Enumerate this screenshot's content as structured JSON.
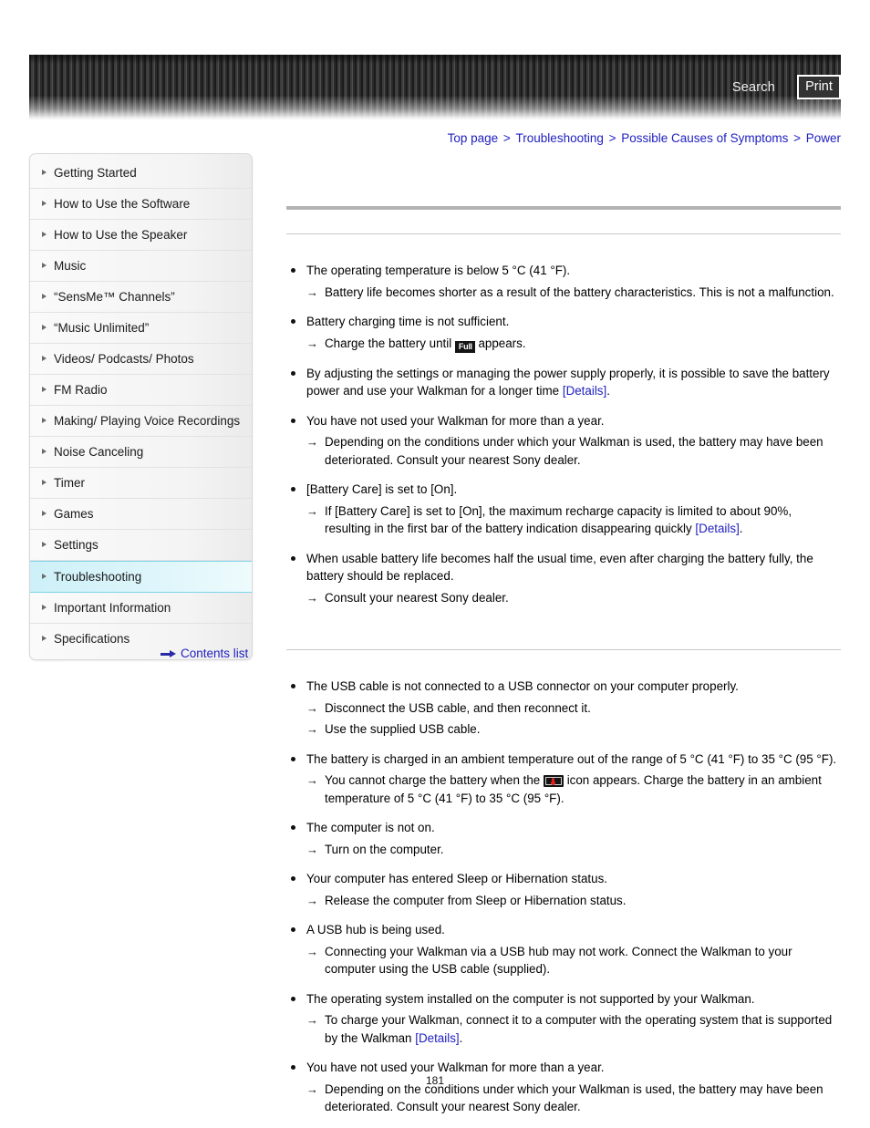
{
  "header": {
    "search_label": "Search",
    "print_label": "Print"
  },
  "breadcrumb": {
    "items": [
      "Top page",
      "Troubleshooting",
      "Possible Causes of Symptoms",
      "Power"
    ],
    "separator": ">"
  },
  "sidebar": {
    "items": [
      {
        "label": "Getting Started",
        "active": false
      },
      {
        "label": "How to Use the Software",
        "active": false
      },
      {
        "label": "How to Use the Speaker",
        "active": false
      },
      {
        "label": "Music",
        "active": false
      },
      {
        "label": "“SensMe™ Channels”",
        "active": false
      },
      {
        "label": "“Music Unlimited”",
        "active": false
      },
      {
        "label": "Videos/ Podcasts/ Photos",
        "active": false
      },
      {
        "label": "FM Radio",
        "active": false
      },
      {
        "label": "Making/ Playing Voice Recordings",
        "active": false
      },
      {
        "label": "Noise Canceling",
        "active": false
      },
      {
        "label": "Timer",
        "active": false
      },
      {
        "label": "Games",
        "active": false
      },
      {
        "label": "Settings",
        "active": false
      },
      {
        "label": "Troubleshooting",
        "active": true
      },
      {
        "label": "Important Information",
        "active": false
      },
      {
        "label": "Specifications",
        "active": false
      }
    ],
    "contents_list_label": "Contents list"
  },
  "content": {
    "section1": {
      "items": [
        {
          "text": "The operating temperature is below 5 °C (41 °F).",
          "subs": [
            {
              "text": "Battery life becomes shorter as a result of the battery characteristics. This is not a malfunction."
            }
          ]
        },
        {
          "text": "Battery charging time is not sufficient.",
          "subs": [
            {
              "before": "Charge the battery until ",
              "icon": "battery-full-icon",
              "icon_text": "Full",
              "after": " appears."
            }
          ]
        },
        {
          "before": "By adjusting the settings or managing the power supply properly, it is possible to save the battery power and use your Walkman for a longer time ",
          "link": "[Details]",
          "after": ".",
          "subs": []
        },
        {
          "text": "You have not used your Walkman for more than a year.",
          "subs": [
            {
              "text": "Depending on the conditions under which your Walkman is used, the battery may have been deteriorated. Consult your nearest Sony dealer."
            }
          ]
        },
        {
          "text": "[Battery Care] is set to [On].",
          "subs": [
            {
              "before": "If [Battery Care] is set to [On], the maximum recharge capacity is limited to about 90%, resulting in the first bar of the battery indication disappearing quickly ",
              "link": "[Details]",
              "after": "."
            }
          ]
        },
        {
          "text": "When usable battery life becomes half the usual time, even after charging the battery fully, the battery should be replaced.",
          "subs": [
            {
              "text": "Consult your nearest Sony dealer."
            }
          ]
        }
      ]
    },
    "section2": {
      "items": [
        {
          "text": "The USB cable is not connected to a USB connector on your computer properly.",
          "subs": [
            {
              "text": "Disconnect the USB cable, and then reconnect it."
            },
            {
              "text": "Use the supplied USB cable."
            }
          ]
        },
        {
          "text": "The battery is charged in an ambient temperature out of the range of 5 °C (41 °F) to 35 °C (95 °F).",
          "subs": [
            {
              "before": "You cannot charge the battery when the ",
              "icon": "battery-temperature-icon",
              "after": " icon appears. Charge the battery in an ambient temperature of 5 °C (41 °F) to 35 °C (95 °F)."
            }
          ]
        },
        {
          "text": "The computer is not on.",
          "subs": [
            {
              "text": "Turn on the computer."
            }
          ]
        },
        {
          "text": "Your computer has entered Sleep or Hibernation status.",
          "subs": [
            {
              "text": "Release the computer from Sleep or Hibernation status."
            }
          ]
        },
        {
          "text": "A USB hub is being used.",
          "subs": [
            {
              "text": "Connecting your Walkman via a USB hub may not work. Connect the Walkman to your computer using the USB cable (supplied)."
            }
          ]
        },
        {
          "text": "The operating system installed on the computer is not supported by your Walkman.",
          "subs": [
            {
              "before": "To charge your Walkman, connect it to a computer with the operating system that is supported by the Walkman ",
              "link": "[Details]",
              "after": "."
            }
          ]
        },
        {
          "text": "You have not used your Walkman for more than a year.",
          "subs": [
            {
              "text": "Depending on the conditions under which your Walkman is used, the battery may have been deteriorated. Consult your nearest Sony dealer."
            }
          ]
        }
      ]
    }
  },
  "page_number": "181",
  "colors": {
    "link": "#2020c0",
    "active_nav_bg": "#d5f2fa",
    "active_nav_border": "#7fd4e8",
    "rule_thick": "#b3b3b3",
    "rule_thin": "#c9c9c9",
    "icon_red": "#e01b1b"
  }
}
